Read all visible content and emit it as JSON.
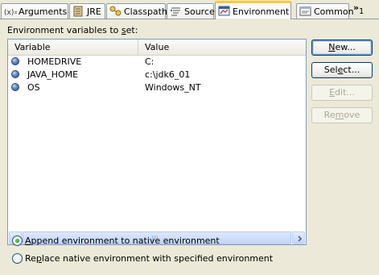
{
  "tabs": [
    {
      "id": "arguments",
      "label": "Arguments",
      "icon": "arguments-icon"
    },
    {
      "id": "jre",
      "label": "JRE",
      "icon": "jre-icon"
    },
    {
      "id": "classpath",
      "label": "Classpath",
      "icon": "classpath-icon"
    },
    {
      "id": "source",
      "label": "Source",
      "icon": "source-icon"
    },
    {
      "id": "environment",
      "label": "Environment",
      "icon": "environment-icon",
      "active": true
    },
    {
      "id": "common",
      "label": "Common",
      "icon": "common-icon"
    }
  ],
  "tab_overflow": {
    "arrows": "»",
    "count": "1"
  },
  "section_label_pre": "Environment variables to ",
  "section_label_mnemonic": "s",
  "section_label_post": "et:",
  "table": {
    "columns": [
      "Variable",
      "Value"
    ],
    "rows": [
      {
        "variable": "HOMEDRIVE",
        "value": "C:"
      },
      {
        "variable": "JAVA_HOME",
        "value": "c:\\jdk6_01"
      },
      {
        "variable": "OS",
        "value": "Windows_NT"
      }
    ]
  },
  "buttons": {
    "new": {
      "mnemonic": "N",
      "rest": "ew...",
      "enabled": true
    },
    "select": {
      "pre": "Sel",
      "mnemonic": "e",
      "rest": "ct...",
      "enabled": true
    },
    "edit": {
      "mnemonic": "E",
      "rest": "dit...",
      "enabled": false
    },
    "remove": {
      "pre": "Re",
      "mnemonic": "m",
      "rest": "ove",
      "enabled": false
    }
  },
  "options": {
    "append": {
      "mnemonic": "A",
      "rest": "ppend environment to native environment",
      "checked": true
    },
    "replace": {
      "pre": "Re",
      "mnemonic": "p",
      "rest": "lace native environment with specified environment",
      "checked": false
    }
  },
  "colors": {
    "background": "#ece9d8",
    "active_tab_accent": "#ffc83c",
    "table_border": "#7f9db9",
    "button_border": "#003c74",
    "disabled_text": "#aca899"
  }
}
